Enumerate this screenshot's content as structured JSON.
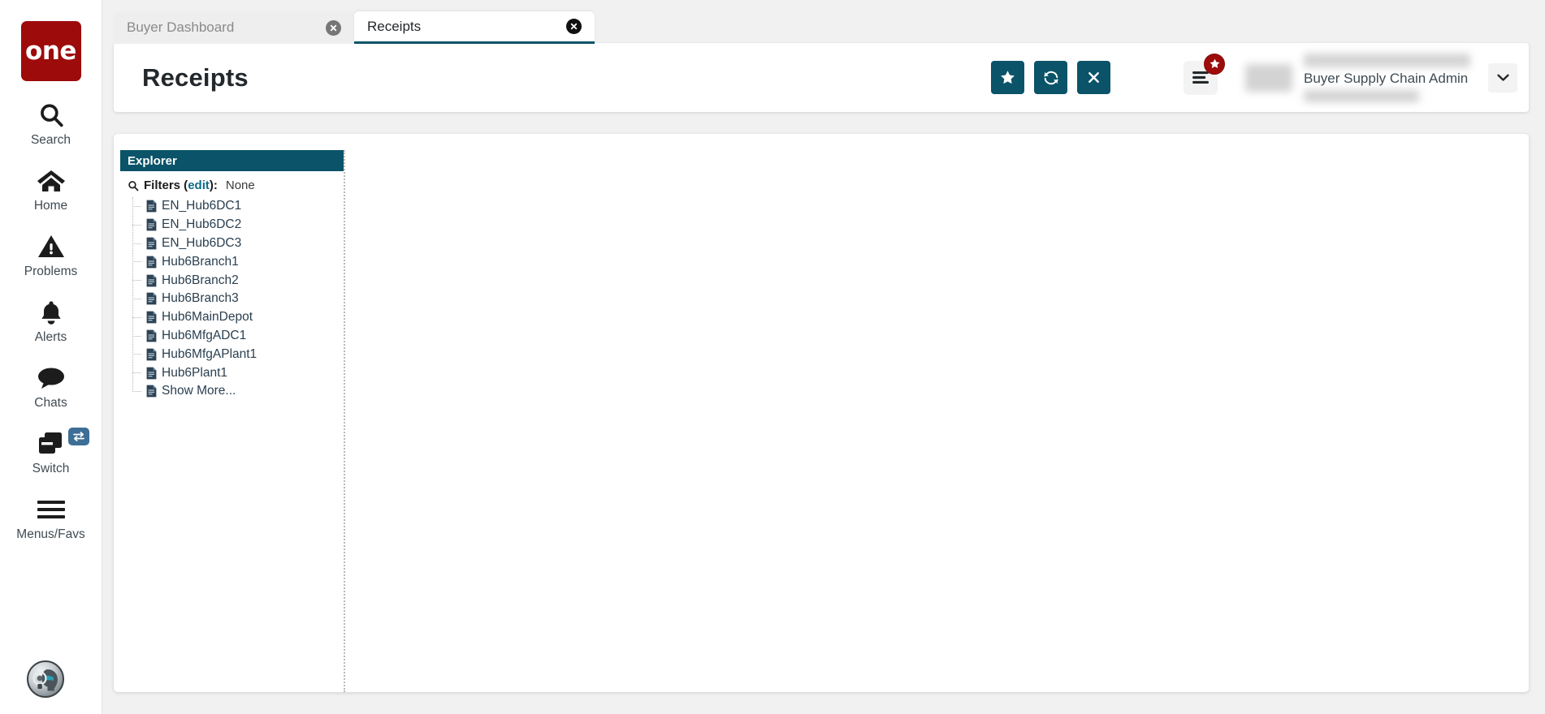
{
  "brand": {
    "wordmark": "one"
  },
  "rail": {
    "items": [
      {
        "label": "Search",
        "icon": "search-icon"
      },
      {
        "label": "Home",
        "icon": "home-icon"
      },
      {
        "label": "Problems",
        "icon": "warning-triangle-icon"
      },
      {
        "label": "Alerts",
        "icon": "bell-icon"
      },
      {
        "label": "Chats",
        "icon": "chat-bubble-icon"
      },
      {
        "label": "Switch",
        "icon": "windows-stack-icon"
      },
      {
        "label": "Menus/Favs",
        "icon": "hamburger-icon"
      }
    ],
    "assistant_avatar": "assistant-avatar-icon"
  },
  "tabs": [
    {
      "label": "Buyer Dashboard",
      "active": false
    },
    {
      "label": "Receipts",
      "active": true
    }
  ],
  "header": {
    "title": "Receipts",
    "actions": [
      {
        "name": "favorite-button",
        "icon": "star-icon"
      },
      {
        "name": "refresh-button",
        "icon": "refresh-icon"
      },
      {
        "name": "close-button",
        "icon": "close-x-icon"
      }
    ],
    "menus_favs": {
      "icon": "hamburger-icon",
      "badge_icon": "star-icon"
    },
    "user": {
      "role": "Buyer Supply Chain Admin"
    },
    "dropdown_icon": "chevron-down-icon"
  },
  "explorer": {
    "title": "Explorer",
    "filters": {
      "icon": "search-icon",
      "label": "Filters (",
      "edit_link": "edit",
      "label_end": "):",
      "value": "None"
    },
    "tree": [
      {
        "label": "EN_Hub6DC1"
      },
      {
        "label": "EN_Hub6DC2"
      },
      {
        "label": "EN_Hub6DC3"
      },
      {
        "label": "Hub6Branch1"
      },
      {
        "label": "Hub6Branch2"
      },
      {
        "label": "Hub6Branch3"
      },
      {
        "label": "Hub6MainDepot"
      },
      {
        "label": "Hub6MfgADC1"
      },
      {
        "label": "Hub6MfgAPlant1"
      },
      {
        "label": "Hub6Plant1"
      },
      {
        "label": "Show More..."
      }
    ]
  },
  "colors": {
    "brand_red": "#9d0b0b",
    "teal": "#0a5369",
    "link_teal": "#0a6b86",
    "switch_badge_blue": "#3d6e96",
    "page_bg": "#f1f1f1"
  }
}
